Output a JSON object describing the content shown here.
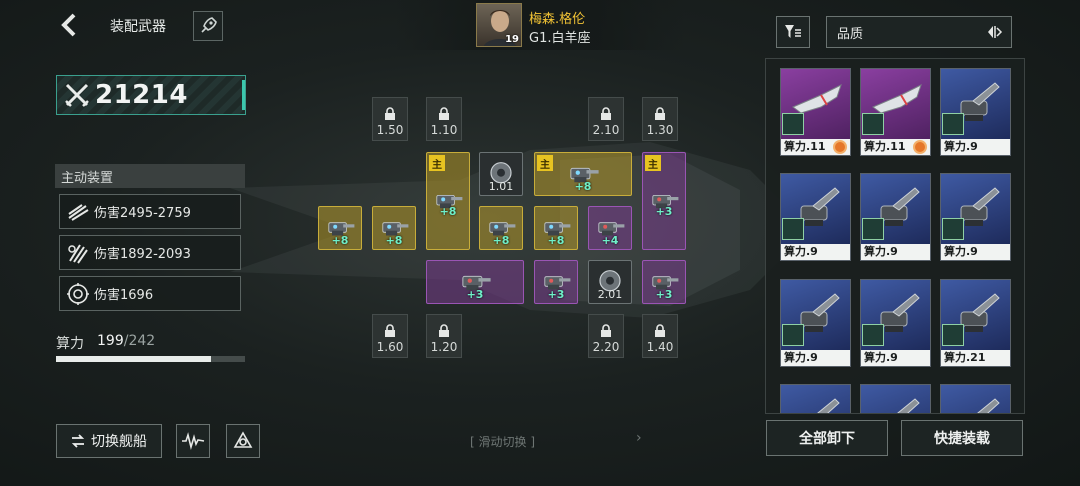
{
  "header": {
    "title": "装配武器",
    "captain_name": "梅森.格伦",
    "captain_rank": "G1.白羊座",
    "captain_level": "19"
  },
  "power": {
    "value": "21214"
  },
  "device_panel": {
    "title": "主动装置",
    "rows": [
      {
        "icon": "claw-slash-icon",
        "text": "伤害2495-2759"
      },
      {
        "icon": "triple-claw-icon",
        "text": "伤害1892-2093"
      },
      {
        "icon": "gear-burst-icon",
        "text": "伤害1696"
      }
    ]
  },
  "compute": {
    "label": "算力",
    "used": "199",
    "sep": "/",
    "max": "242",
    "fill_fraction": 0.822
  },
  "bottom": {
    "switch_ship": "切换舰船",
    "swipe_hint": "滑动切换",
    "unequip_all": "全部卸下",
    "quick_equip": "快捷装载"
  },
  "locked_slots": [
    "1.50",
    "1.10",
    "2.10",
    "1.30",
    "1.60",
    "1.20",
    "2.20",
    "1.40"
  ],
  "weapon_slots": [
    {
      "id": "w1",
      "style": "gold",
      "bonus": "+8"
    },
    {
      "id": "w2",
      "style": "gold",
      "bonus": "+8"
    },
    {
      "id": "w3",
      "style": "gold",
      "bonus": "+8",
      "tag": "主"
    },
    {
      "id": "w4",
      "style": "dark",
      "value": "1.01"
    },
    {
      "id": "w5",
      "style": "gold",
      "bonus": "+8",
      "tag": "主"
    },
    {
      "id": "w6",
      "style": "purple",
      "bonus": "+3",
      "tag": "主"
    },
    {
      "id": "w7",
      "style": "gold",
      "bonus": "+8"
    },
    {
      "id": "w8",
      "style": "gold",
      "bonus": "+8"
    },
    {
      "id": "w9",
      "style": "purple",
      "bonus": "+4"
    },
    {
      "id": "w10",
      "style": "purple",
      "bonus": "+3"
    },
    {
      "id": "w11",
      "style": "purple",
      "bonus": "+3"
    },
    {
      "id": "w12",
      "style": "dark",
      "value": "2.01"
    },
    {
      "id": "w13",
      "style": "purple",
      "bonus": "+3"
    }
  ],
  "inventory": {
    "sort_label": "品质",
    "items": [
      {
        "rarity": "purple",
        "label": "算力.11",
        "gear": true
      },
      {
        "rarity": "purple",
        "label": "算力.11",
        "gear": true
      },
      {
        "rarity": "blue",
        "label": "算力.9",
        "gear": false
      },
      {
        "rarity": "blue",
        "label": "算力.9",
        "gear": false
      },
      {
        "rarity": "blue",
        "label": "算力.9",
        "gear": false
      },
      {
        "rarity": "blue",
        "label": "算力.9",
        "gear": false
      },
      {
        "rarity": "blue",
        "label": "算力.9",
        "gear": false
      },
      {
        "rarity": "blue",
        "label": "算力.9",
        "gear": false
      },
      {
        "rarity": "blue",
        "label": "算力.21",
        "gear": false
      },
      {
        "rarity": "blue",
        "label": "",
        "gear": false
      },
      {
        "rarity": "blue",
        "label": "",
        "gear": false
      },
      {
        "rarity": "blue",
        "label": "",
        "gear": false
      }
    ]
  },
  "colors": {
    "gold_slot": "#c8ad3a",
    "purple_slot": "#9a55b4",
    "bonus_text": "#6ff0c9",
    "captain_name": "#f2c335",
    "accent_teal": "#3cc7ad"
  }
}
